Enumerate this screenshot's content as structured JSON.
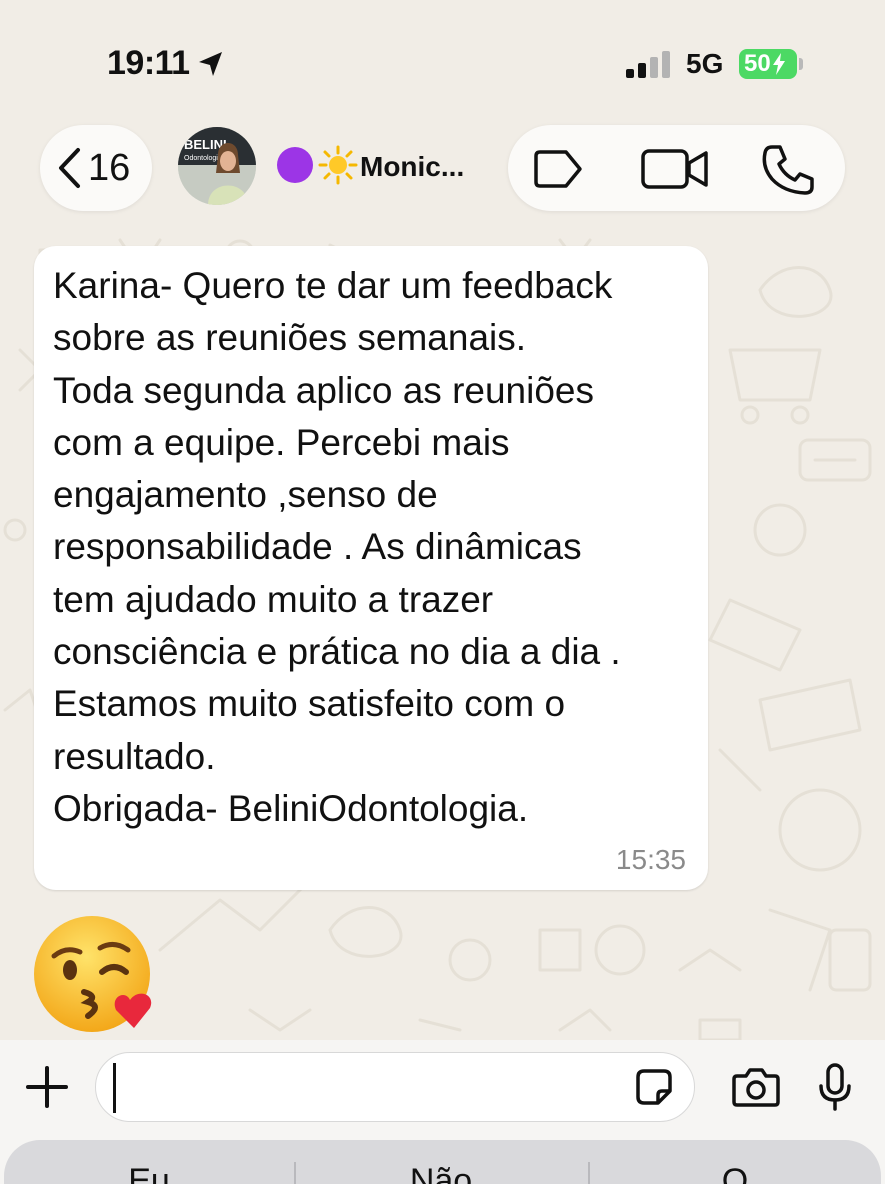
{
  "status_bar": {
    "time": "19:11",
    "network": "5G",
    "battery": "50"
  },
  "header": {
    "back_count": "16",
    "contact_name": "Monic...",
    "avatar_text": "BELINI",
    "avatar_subtext": "Odontologia"
  },
  "message": {
    "text": "Karina- Quero te dar um feedback\nsobre as reuniões semanais.\nToda segunda aplico as reuniões\ncom a equipe. Percebi mais\nengajamento ,senso de\nresponsabilidade . As dinâmicas\ntem ajudado muito a trazer\nconsciência e prática no dia a dia .\nEstamos muito satisfeito com o\nresultado.\nObrigada- BeliniOdontologia.",
    "time": "15:35"
  },
  "emoji_message": "face-blowing-a-kiss",
  "input": {
    "value": "",
    "placeholder": ""
  },
  "keyboard": {
    "suggestions": [
      "Eu",
      "Não",
      "O"
    ]
  },
  "colors": {
    "battery": "#4cd964",
    "status_purple": "#9c35e6",
    "bubble": "#ffffff",
    "background": "#f1ede6"
  },
  "icons": [
    "location-arrow-icon",
    "signal-icon",
    "back-chevron-icon",
    "sun-icon",
    "label-icon",
    "video-call-icon",
    "phone-icon",
    "plus-icon",
    "sticker-icon",
    "camera-icon",
    "mic-icon"
  ]
}
